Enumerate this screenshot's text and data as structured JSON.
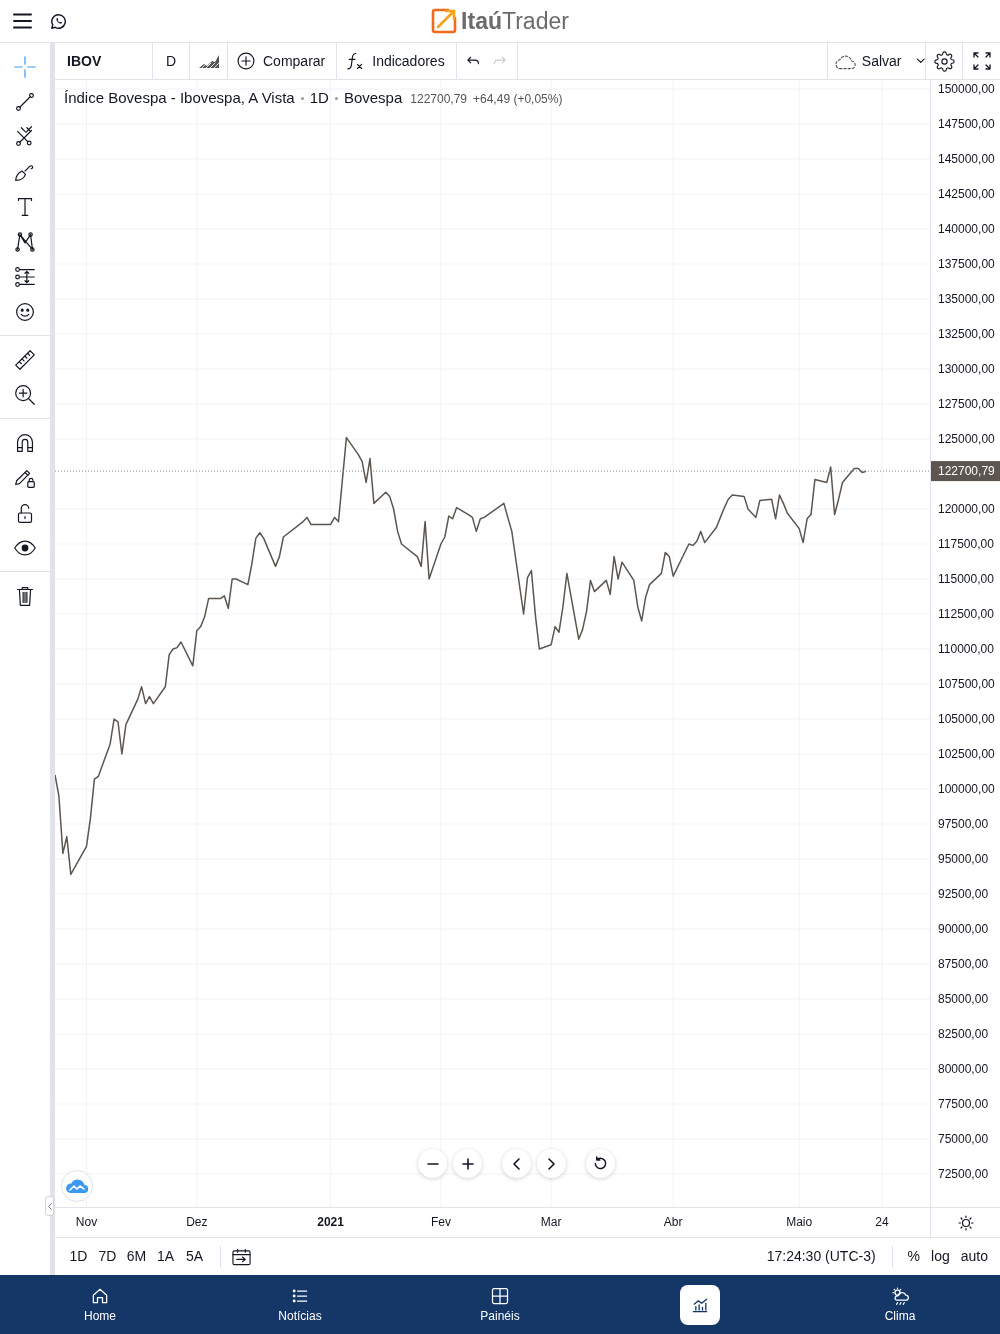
{
  "header": {
    "logo": "**Itaú**Trader"
  },
  "left_toolbar": {
    "groups": [
      {
        "tools": [
          {
            "kind": "crosshair",
            "selected": true
          },
          {
            "kind": "trend-line",
            "selected": false
          },
          {
            "kind": "pitchfork",
            "selected": false
          },
          {
            "kind": "brush",
            "selected": false
          },
          {
            "kind": "text",
            "selected": false
          },
          {
            "kind": "pattern",
            "selected": false
          },
          {
            "kind": "measure",
            "selected": false
          },
          {
            "kind": "emoji",
            "selected": false
          }
        ]
      },
      {
        "tools": [
          {
            "kind": "ruler",
            "selected": false
          },
          {
            "kind": "zoom",
            "selected": false
          }
        ]
      },
      {
        "tools": [
          {
            "kind": "magnet",
            "selected": false
          },
          {
            "kind": "draw-lock",
            "selected": false
          },
          {
            "kind": "lock",
            "selected": false
          },
          {
            "kind": "eye",
            "selected": false
          }
        ]
      },
      {
        "tools": [
          {
            "kind": "trash",
            "selected": false
          }
        ]
      }
    ]
  },
  "chart_toolbar": {
    "symbol": "IBOV",
    "interval": "D",
    "buttons": [
      {
        "kind": "compare",
        "label": "Comparar"
      },
      {
        "kind": "indicators",
        "label": "Indicadores"
      }
    ],
    "history": [
      {
        "kind": "undo",
        "disabled": false
      },
      {
        "kind": "redo",
        "disabled": true
      }
    ],
    "save": {
      "label": "Salvar"
    }
  },
  "chart": {
    "legend": {
      "title": "Índice Bovespa - Ibovespa, A Vista",
      "interval": "1D",
      "exchange": "Bovespa",
      "price": "122700,79",
      "change": "+64,49 (+0,05%)"
    },
    "chart_data": {
      "type": "line",
      "grid": true,
      "xlim": [
        "2020-10-26",
        "2021-06-23"
      ],
      "ylim": [
        70140,
        150640
      ],
      "x": [
        "2020-10-26",
        "2020-10-27",
        "2020-10-28",
        "2020-10-29",
        "2020-10-30",
        "2020-11-03",
        "2020-11-04",
        "2020-11-05",
        "2020-11-06",
        "2020-11-09",
        "2020-11-10",
        "2020-11-11",
        "2020-11-12",
        "2020-11-13",
        "2020-11-16",
        "2020-11-17",
        "2020-11-18",
        "2020-11-19",
        "2020-11-20",
        "2020-11-23",
        "2020-11-24",
        "2020-11-25",
        "2020-11-26",
        "2020-11-27",
        "2020-11-30",
        "2020-12-01",
        "2020-12-02",
        "2020-12-03",
        "2020-12-04",
        "2020-12-07",
        "2020-12-08",
        "2020-12-09",
        "2020-12-10",
        "2020-12-11",
        "2020-12-14",
        "2020-12-15",
        "2020-12-16",
        "2020-12-17",
        "2020-12-18",
        "2020-12-21",
        "2020-12-22",
        "2020-12-23",
        "2020-12-28",
        "2020-12-29",
        "2020-12-30",
        "2021-01-04",
        "2021-01-05",
        "2021-01-06",
        "2021-01-07",
        "2021-01-08",
        "2021-01-11",
        "2021-01-12",
        "2021-01-13",
        "2021-01-14",
        "2021-01-15",
        "2021-01-18",
        "2021-01-19",
        "2021-01-20",
        "2021-01-21",
        "2021-01-22",
        "2021-01-26",
        "2021-01-27",
        "2021-01-28",
        "2021-01-29",
        "2021-02-01",
        "2021-02-02",
        "2021-02-03",
        "2021-02-04",
        "2021-02-05",
        "2021-02-08",
        "2021-02-09",
        "2021-02-10",
        "2021-02-11",
        "2021-02-12",
        "2021-02-17",
        "2021-02-18",
        "2021-02-19",
        "2021-02-22",
        "2021-02-23",
        "2021-02-24",
        "2021-02-25",
        "2021-02-26",
        "2021-03-01",
        "2021-03-02",
        "2021-03-03",
        "2021-03-04",
        "2021-03-05",
        "2021-03-08",
        "2021-03-09",
        "2021-03-10",
        "2021-03-11",
        "2021-03-12",
        "2021-03-15",
        "2021-03-16",
        "2021-03-17",
        "2021-03-18",
        "2021-03-19",
        "2021-03-22",
        "2021-03-23",
        "2021-03-24",
        "2021-03-25",
        "2021-03-26",
        "2021-03-29",
        "2021-03-30",
        "2021-03-31",
        "2021-04-01",
        "2021-04-05",
        "2021-04-06",
        "2021-04-07",
        "2021-04-08",
        "2021-04-09",
        "2021-04-12",
        "2021-04-13",
        "2021-04-14",
        "2021-04-15",
        "2021-04-16",
        "2021-04-19",
        "2021-04-20",
        "2021-04-22",
        "2021-04-23",
        "2021-04-26",
        "2021-04-27",
        "2021-04-28",
        "2021-04-29",
        "2021-04-30",
        "2021-05-03",
        "2021-05-04",
        "2021-05-05",
        "2021-05-06",
        "2021-05-07",
        "2021-05-10",
        "2021-05-11",
        "2021-05-12",
        "2021-05-13",
        "2021-05-14",
        "2021-05-17",
        "2021-05-18",
        "2021-05-19",
        "2021-05-20"
      ],
      "xticks": [
        {
          "value": "2020-11-03",
          "label": "Nov"
        },
        {
          "value": "2020-12-01",
          "label": "Dez"
        },
        {
          "value": "2021-01-04",
          "label": "2021"
        },
        {
          "value": "2021-02-01",
          "label": "Fev"
        },
        {
          "value": "2021-03-01",
          "label": "Mar"
        },
        {
          "value": "2021-04-01",
          "label": "Abr"
        },
        {
          "value": "2021-05-03",
          "label": "Maio"
        },
        {
          "value": "2021-05-24",
          "label": "24"
        }
      ],
      "yticks": [
        {
          "value": 150000,
          "label": "150000,00"
        },
        {
          "value": 147500,
          "label": "147500,00"
        },
        {
          "value": 145000,
          "label": "145000,00"
        },
        {
          "value": 142500,
          "label": "142500,00"
        },
        {
          "value": 140000,
          "label": "140000,00"
        },
        {
          "value": 137500,
          "label": "137500,00"
        },
        {
          "value": 135000,
          "label": "135000,00"
        },
        {
          "value": 132500,
          "label": "132500,00"
        },
        {
          "value": 130000,
          "label": "130000,00"
        },
        {
          "value": 127500,
          "label": "127500,00"
        },
        {
          "value": 125000,
          "label": "125000,00"
        },
        {
          "value": 120000,
          "label": "120000,00"
        },
        {
          "value": 117500,
          "label": "117500,00"
        },
        {
          "value": 115000,
          "label": "115000,00"
        },
        {
          "value": 112500,
          "label": "112500,00"
        },
        {
          "value": 110000,
          "label": "110000,00"
        },
        {
          "value": 107500,
          "label": "107500,00"
        },
        {
          "value": 105000,
          "label": "105000,00"
        },
        {
          "value": 102500,
          "label": "102500,00"
        },
        {
          "value": 100000,
          "label": "100000,00"
        },
        {
          "value": 97500,
          "label": "97500,00"
        },
        {
          "value": 95000,
          "label": "95000,00"
        },
        {
          "value": 92500,
          "label": "92500,00"
        },
        {
          "value": 90000,
          "label": "90000,00"
        },
        {
          "value": 87500,
          "label": "87500,00"
        },
        {
          "value": 85000,
          "label": "85000,00"
        },
        {
          "value": 82500,
          "label": "82500,00"
        },
        {
          "value": 80000,
          "label": "80000,00"
        },
        {
          "value": 77500,
          "label": "77500,00"
        },
        {
          "value": 75000,
          "label": "75000,00"
        },
        {
          "value": 72500,
          "label": "72500,00"
        }
      ],
      "series": [
        {
          "color": "#5d5650",
          "values": [
            101000,
            99500,
            95400,
            96600,
            93900,
            95900,
            97900,
            100700,
            100900,
            103200,
            105000,
            104800,
            102500,
            104600,
            106400,
            107300,
            106100,
            106600,
            106100,
            107300,
            109600,
            110000,
            110100,
            110500,
            108800,
            111300,
            111600,
            112300,
            113600,
            113600,
            113800,
            112900,
            115000,
            115000,
            114600,
            116100,
            117900,
            118300,
            117900,
            115900,
            116600,
            118000,
            119100,
            119400,
            118900,
            118900,
            119400,
            119100,
            122100,
            125100,
            123900,
            123400,
            121900,
            123600,
            120400,
            121200,
            120900,
            120000,
            118400,
            117500,
            116600,
            115900,
            119100,
            115000,
            117500,
            118000,
            119500,
            119300,
            120100,
            119600,
            119400,
            118400,
            119300,
            119400,
            120400,
            119400,
            118400,
            112500,
            115100,
            115600,
            112400,
            110000,
            110300,
            111600,
            111200,
            113000,
            115400,
            110700,
            111400,
            112700,
            114900,
            114100,
            114900,
            113900,
            116600,
            115000,
            116200,
            114900,
            113000,
            112000,
            113700,
            114600,
            115400,
            116900,
            116600,
            115200,
            117500,
            117400,
            117700,
            118400,
            117600,
            118700,
            119400,
            120100,
            120700,
            121000,
            120900,
            120000,
            119400,
            120600,
            120700,
            119300,
            121000,
            120400,
            119700,
            118600,
            117600,
            119300,
            119600,
            122100,
            121900,
            123000,
            119600,
            120700,
            121900,
            122900,
            122900,
            122600,
            122700
          ]
        }
      ],
      "ref_lines": [
        {
          "axis": "y",
          "value": 122700.79,
          "label": "122700,79",
          "color": "#8c8c8c"
        }
      ]
    },
    "time_axis": {
      "ticks": [
        {
          "bold": false
        },
        {
          "bold": false
        },
        {
          "bold": true
        },
        {
          "bold": false
        },
        {
          "bold": false
        },
        {
          "bold": false
        },
        {
          "bold": false
        },
        {
          "bold": false
        }
      ]
    }
  },
  "bottom_toolbar": {
    "ranges": [
      "1D",
      "7D",
      "6M",
      "1A",
      "5A"
    ],
    "clock": "17:24:30 (UTC-3)",
    "scale_options": [
      "%",
      "log",
      "auto"
    ]
  },
  "bottom_nav": {
    "items": [
      {
        "kind": "home",
        "label": "Home",
        "selected": false
      },
      {
        "kind": "news",
        "label": "Notícias",
        "selected": false
      },
      {
        "kind": "panels",
        "label": "Painéis",
        "selected": false
      },
      {
        "kind": "chart",
        "selected": true
      },
      {
        "kind": "weather",
        "label": "Clima",
        "selected": false
      }
    ]
  }
}
